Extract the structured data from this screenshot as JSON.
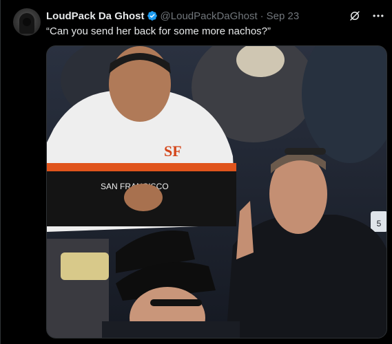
{
  "post": {
    "author_name": "LoudPack Da Ghost",
    "author_handle": "@LoudPackDaGhost",
    "separator": "·",
    "date": "Sep 23",
    "text": "“Can you send her back for some more nachos?”",
    "verified": true
  },
  "media": {
    "type": "video-still",
    "sign_text": "SAN FRANCISCO",
    "logo_text": "SF",
    "seat_number": "5"
  },
  "colors": {
    "background": "#000000",
    "text_primary": "#e7e9ea",
    "text_secondary": "#71767b",
    "verified_blue": "#1d9bf0",
    "giants_orange": "#fd5a1e"
  },
  "icons": [
    "verified-badge-icon",
    "grok-icon",
    "more-options-icon"
  ]
}
